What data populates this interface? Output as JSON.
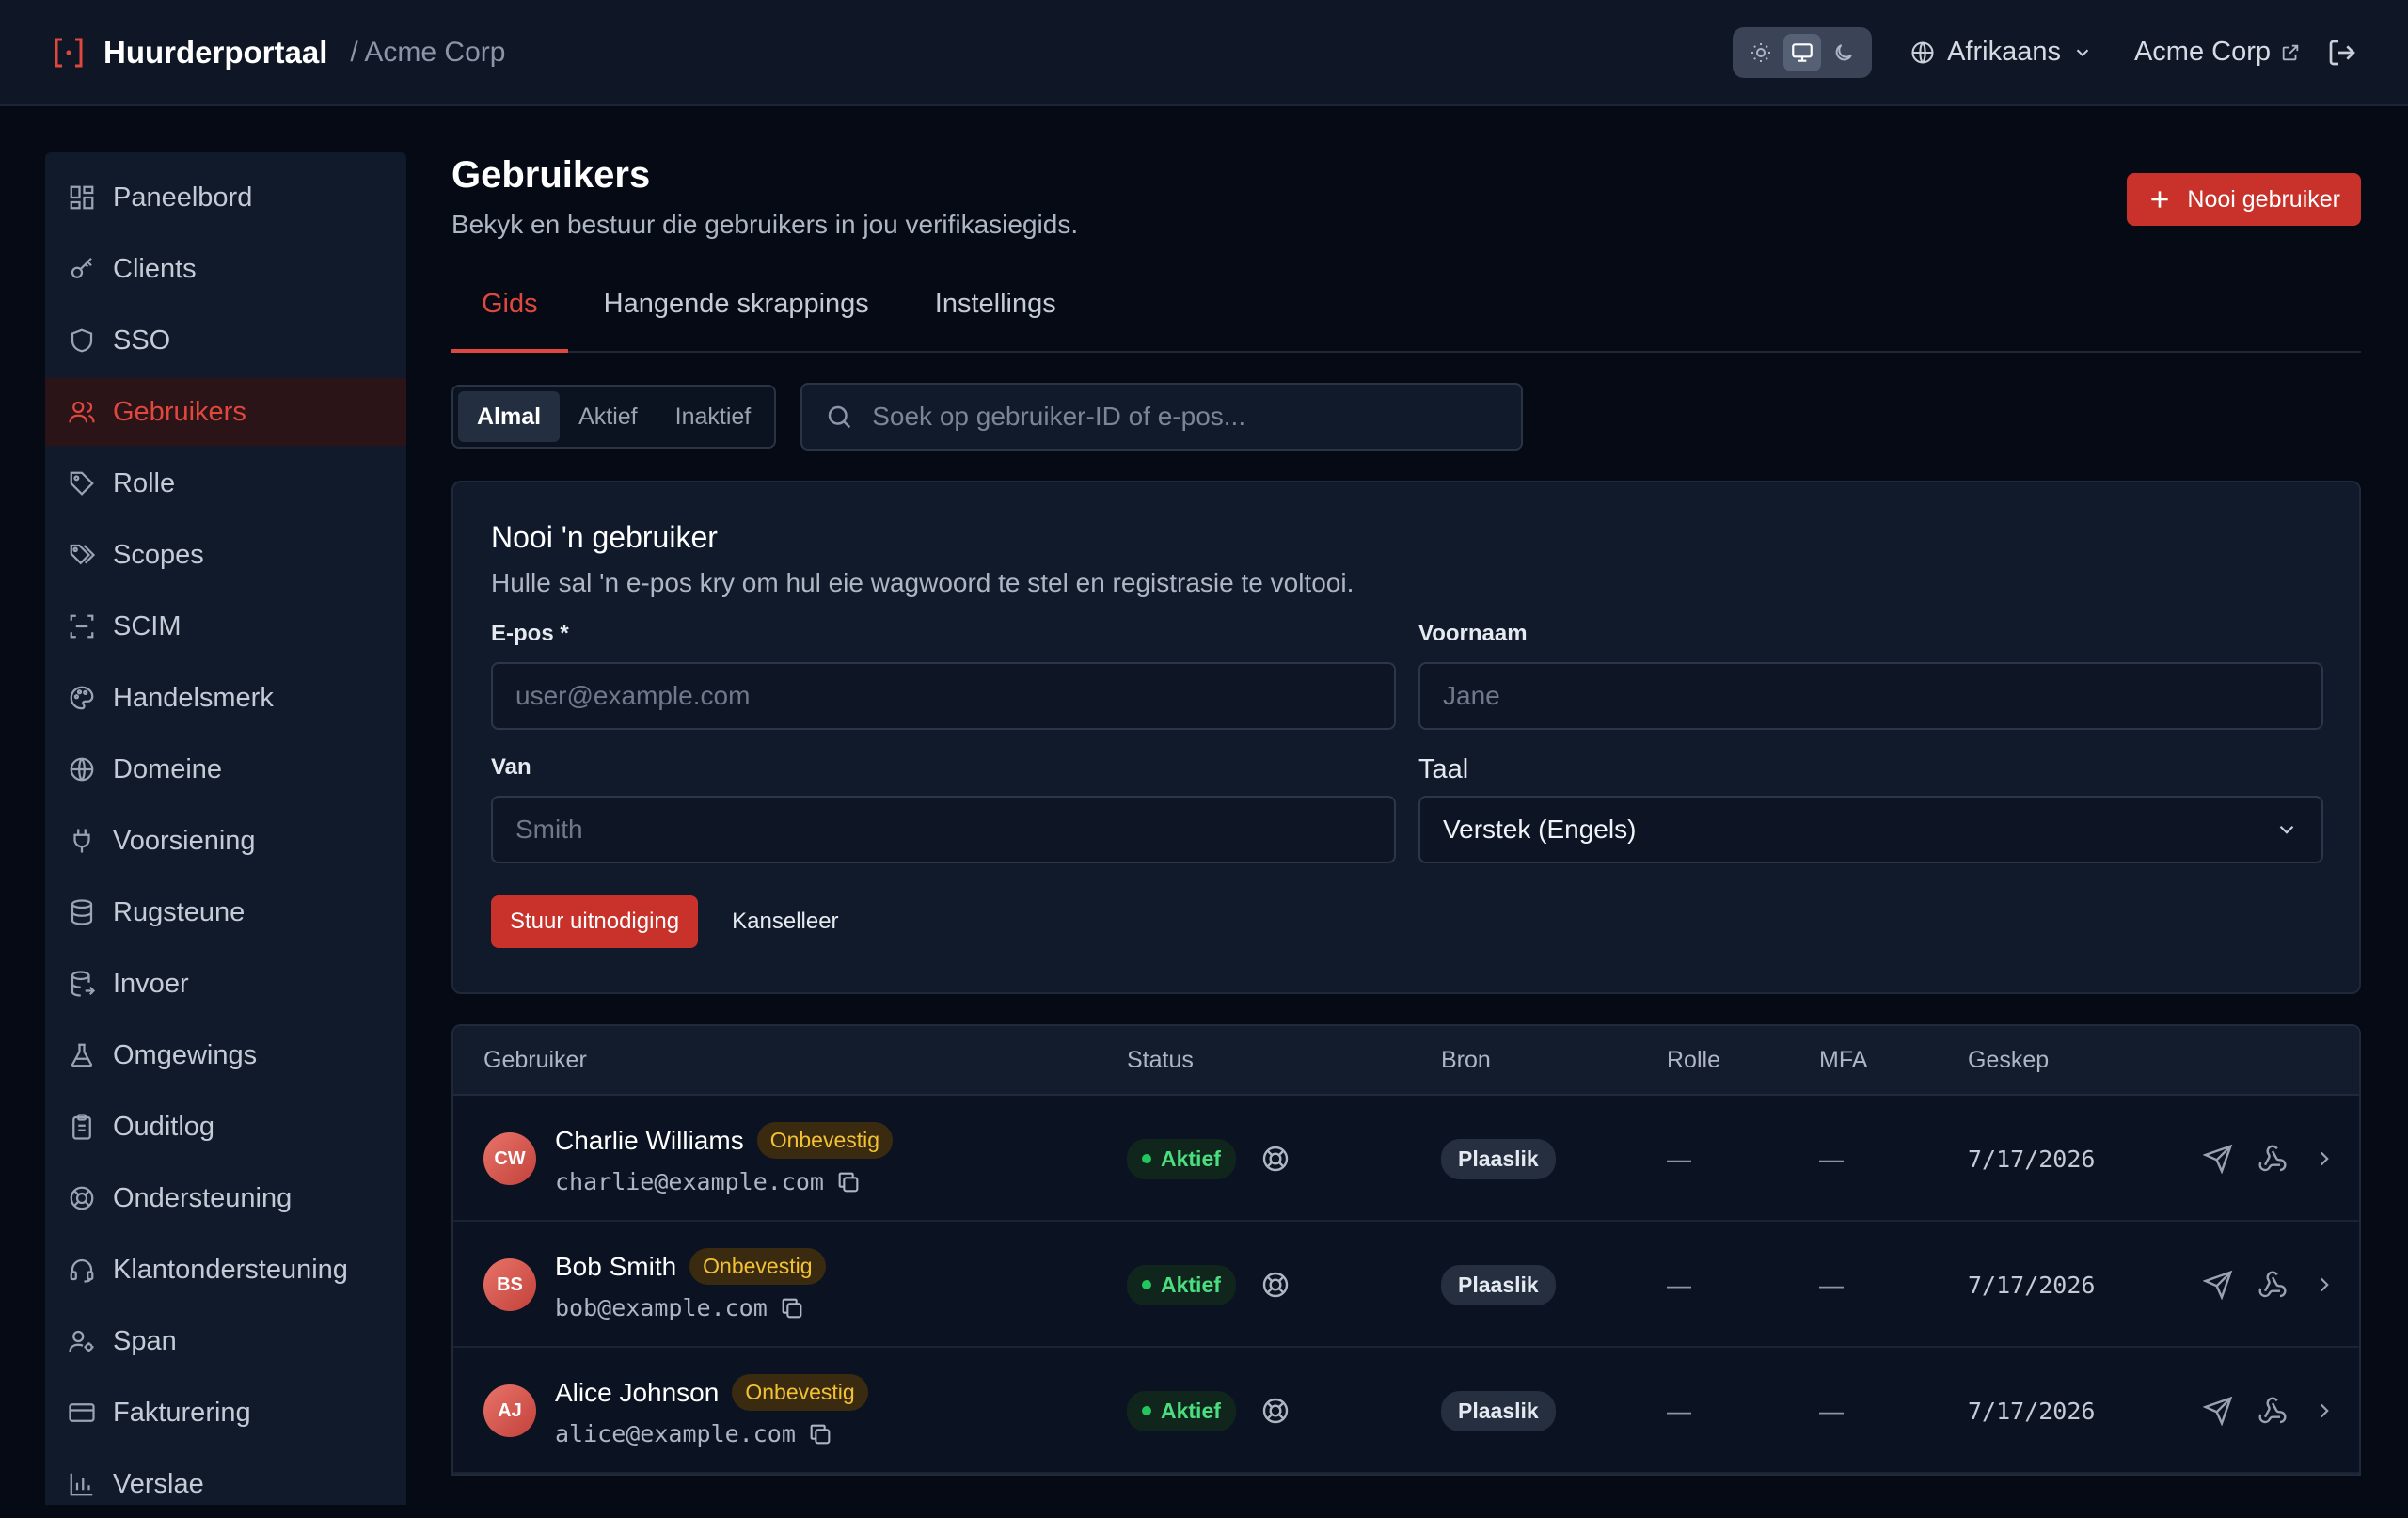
{
  "topbar": {
    "title": "Huurderportaal",
    "org_crumb": "/ Acme Corp",
    "language": "Afrikaans",
    "org_link": "Acme Corp"
  },
  "sidebar": {
    "items": [
      {
        "label": "Paneelbord",
        "icon": "dashboard-icon"
      },
      {
        "label": "Clients",
        "icon": "key-icon"
      },
      {
        "label": "SSO",
        "icon": "shield-icon"
      },
      {
        "label": "Gebruikers",
        "icon": "users-icon",
        "active": true
      },
      {
        "label": "Rolle",
        "icon": "tag-icon"
      },
      {
        "label": "Scopes",
        "icon": "tags-icon"
      },
      {
        "label": "SCIM",
        "icon": "scan-icon"
      },
      {
        "label": "Handelsmerk",
        "icon": "palette-icon"
      },
      {
        "label": "Domeine",
        "icon": "globe-icon"
      },
      {
        "label": "Voorsiening",
        "icon": "plug-icon"
      },
      {
        "label": "Rugsteune",
        "icon": "database-icon"
      },
      {
        "label": "Invoer",
        "icon": "database-import-icon"
      },
      {
        "label": "Omgewings",
        "icon": "flask-icon"
      },
      {
        "label": "Ouditlog",
        "icon": "clipboard-icon"
      },
      {
        "label": "Ondersteuning",
        "icon": "lifebuoy-icon"
      },
      {
        "label": "Klantondersteuning",
        "icon": "headset-icon"
      },
      {
        "label": "Span",
        "icon": "user-cog-icon"
      },
      {
        "label": "Fakturering",
        "icon": "credit-card-icon"
      },
      {
        "label": "Verslae",
        "icon": "bar-chart-icon"
      }
    ]
  },
  "page": {
    "title": "Gebruikers",
    "subtitle": "Bekyk en bestuur die gebruikers in jou verifikasiegids.",
    "invite_button": "Nooi gebruiker"
  },
  "tabs": [
    "Gids",
    "Hangende skrappings",
    "Instellings"
  ],
  "filter": {
    "segments": [
      "Almal",
      "Aktief",
      "Inaktief"
    ],
    "search_placeholder": "Soek op gebruiker-ID of e-pos..."
  },
  "invite_form": {
    "title": "Nooi 'n gebruiker",
    "subtitle": "Hulle sal 'n e-pos kry om hul eie wagwoord te stel en registrasie te voltooi.",
    "email_label": "E-pos *",
    "email_placeholder": "user@example.com",
    "first_name_label": "Voornaam",
    "first_name_placeholder": "Jane",
    "last_name_label": "Van",
    "last_name_placeholder": "Smith",
    "language_label": "Taal",
    "language_value": "Verstek (Engels)",
    "send_button": "Stuur uitnodiging",
    "cancel_button": "Kanselleer"
  },
  "table": {
    "columns": [
      "Gebruiker",
      "Status",
      "Bron",
      "Rolle",
      "MFA",
      "Geskep"
    ],
    "rows": [
      {
        "initials": "CW",
        "name": "Charlie Williams",
        "badge": "Onbevestig",
        "email": "charlie@example.com",
        "status": "Aktief",
        "source": "Plaaslik",
        "roles": "—",
        "mfa": "—",
        "created": "7/17/2026"
      },
      {
        "initials": "BS",
        "name": "Bob Smith",
        "badge": "Onbevestig",
        "email": "bob@example.com",
        "status": "Aktief",
        "source": "Plaaslik",
        "roles": "—",
        "mfa": "—",
        "created": "7/17/2026"
      },
      {
        "initials": "AJ",
        "name": "Alice Johnson",
        "badge": "Onbevestig",
        "email": "alice@example.com",
        "status": "Aktief",
        "source": "Plaaslik",
        "roles": "—",
        "mfa": "—",
        "created": "7/17/2026"
      }
    ]
  },
  "colors": {
    "accent": "#e0473d",
    "primary_button": "#c8322b",
    "background": "#050a14",
    "panel": "#111a2a",
    "success": "#22c55e",
    "warning": "#f3c233"
  }
}
